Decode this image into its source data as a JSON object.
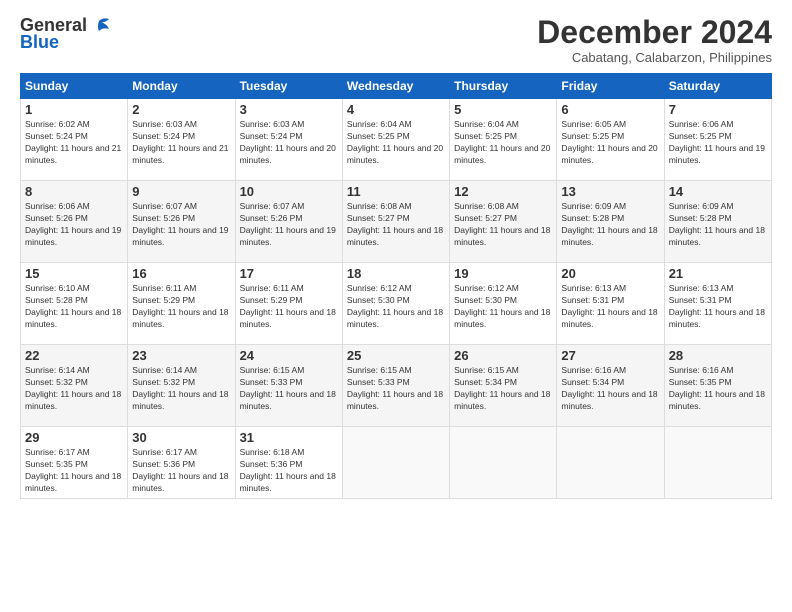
{
  "logo": {
    "general": "General",
    "blue": "Blue"
  },
  "header": {
    "month": "December 2024",
    "location": "Cabatang, Calabarzon, Philippines"
  },
  "weekdays": [
    "Sunday",
    "Monday",
    "Tuesday",
    "Wednesday",
    "Thursday",
    "Friday",
    "Saturday"
  ],
  "weeks": [
    [
      {
        "day": "1",
        "sunrise": "6:02 AM",
        "sunset": "5:24 PM",
        "daylight": "11 hours and 21 minutes."
      },
      {
        "day": "2",
        "sunrise": "6:03 AM",
        "sunset": "5:24 PM",
        "daylight": "11 hours and 21 minutes."
      },
      {
        "day": "3",
        "sunrise": "6:03 AM",
        "sunset": "5:24 PM",
        "daylight": "11 hours and 20 minutes."
      },
      {
        "day": "4",
        "sunrise": "6:04 AM",
        "sunset": "5:25 PM",
        "daylight": "11 hours and 20 minutes."
      },
      {
        "day": "5",
        "sunrise": "6:04 AM",
        "sunset": "5:25 PM",
        "daylight": "11 hours and 20 minutes."
      },
      {
        "day": "6",
        "sunrise": "6:05 AM",
        "sunset": "5:25 PM",
        "daylight": "11 hours and 20 minutes."
      },
      {
        "day": "7",
        "sunrise": "6:06 AM",
        "sunset": "5:25 PM",
        "daylight": "11 hours and 19 minutes."
      }
    ],
    [
      {
        "day": "8",
        "sunrise": "6:06 AM",
        "sunset": "5:26 PM",
        "daylight": "11 hours and 19 minutes."
      },
      {
        "day": "9",
        "sunrise": "6:07 AM",
        "sunset": "5:26 PM",
        "daylight": "11 hours and 19 minutes."
      },
      {
        "day": "10",
        "sunrise": "6:07 AM",
        "sunset": "5:26 PM",
        "daylight": "11 hours and 19 minutes."
      },
      {
        "day": "11",
        "sunrise": "6:08 AM",
        "sunset": "5:27 PM",
        "daylight": "11 hours and 18 minutes."
      },
      {
        "day": "12",
        "sunrise": "6:08 AM",
        "sunset": "5:27 PM",
        "daylight": "11 hours and 18 minutes."
      },
      {
        "day": "13",
        "sunrise": "6:09 AM",
        "sunset": "5:28 PM",
        "daylight": "11 hours and 18 minutes."
      },
      {
        "day": "14",
        "sunrise": "6:09 AM",
        "sunset": "5:28 PM",
        "daylight": "11 hours and 18 minutes."
      }
    ],
    [
      {
        "day": "15",
        "sunrise": "6:10 AM",
        "sunset": "5:28 PM",
        "daylight": "11 hours and 18 minutes."
      },
      {
        "day": "16",
        "sunrise": "6:11 AM",
        "sunset": "5:29 PM",
        "daylight": "11 hours and 18 minutes."
      },
      {
        "day": "17",
        "sunrise": "6:11 AM",
        "sunset": "5:29 PM",
        "daylight": "11 hours and 18 minutes."
      },
      {
        "day": "18",
        "sunrise": "6:12 AM",
        "sunset": "5:30 PM",
        "daylight": "11 hours and 18 minutes."
      },
      {
        "day": "19",
        "sunrise": "6:12 AM",
        "sunset": "5:30 PM",
        "daylight": "11 hours and 18 minutes."
      },
      {
        "day": "20",
        "sunrise": "6:13 AM",
        "sunset": "5:31 PM",
        "daylight": "11 hours and 18 minutes."
      },
      {
        "day": "21",
        "sunrise": "6:13 AM",
        "sunset": "5:31 PM",
        "daylight": "11 hours and 18 minutes."
      }
    ],
    [
      {
        "day": "22",
        "sunrise": "6:14 AM",
        "sunset": "5:32 PM",
        "daylight": "11 hours and 18 minutes."
      },
      {
        "day": "23",
        "sunrise": "6:14 AM",
        "sunset": "5:32 PM",
        "daylight": "11 hours and 18 minutes."
      },
      {
        "day": "24",
        "sunrise": "6:15 AM",
        "sunset": "5:33 PM",
        "daylight": "11 hours and 18 minutes."
      },
      {
        "day": "25",
        "sunrise": "6:15 AM",
        "sunset": "5:33 PM",
        "daylight": "11 hours and 18 minutes."
      },
      {
        "day": "26",
        "sunrise": "6:15 AM",
        "sunset": "5:34 PM",
        "daylight": "11 hours and 18 minutes."
      },
      {
        "day": "27",
        "sunrise": "6:16 AM",
        "sunset": "5:34 PM",
        "daylight": "11 hours and 18 minutes."
      },
      {
        "day": "28",
        "sunrise": "6:16 AM",
        "sunset": "5:35 PM",
        "daylight": "11 hours and 18 minutes."
      }
    ],
    [
      {
        "day": "29",
        "sunrise": "6:17 AM",
        "sunset": "5:35 PM",
        "daylight": "11 hours and 18 minutes."
      },
      {
        "day": "30",
        "sunrise": "6:17 AM",
        "sunset": "5:36 PM",
        "daylight": "11 hours and 18 minutes."
      },
      {
        "day": "31",
        "sunrise": "6:18 AM",
        "sunset": "5:36 PM",
        "daylight": "11 hours and 18 minutes."
      },
      null,
      null,
      null,
      null
    ]
  ]
}
